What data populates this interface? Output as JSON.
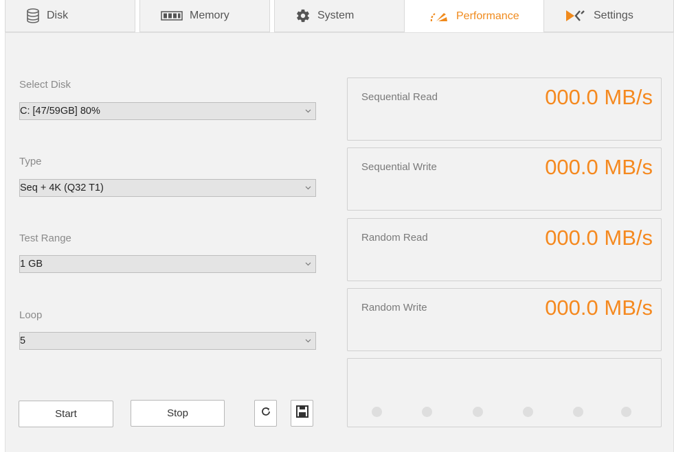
{
  "tabs": [
    {
      "label": "Disk",
      "icon": "database-icon"
    },
    {
      "label": "Memory",
      "icon": "memory-chip-icon"
    },
    {
      "label": "System",
      "icon": "gear-icon"
    },
    {
      "label": "Performance",
      "icon": "speedometer-icon",
      "active": true
    },
    {
      "label": "Settings",
      "icon": "x-logo-icon"
    }
  ],
  "form": {
    "select_disk": {
      "label": "Select Disk",
      "value": "C: [47/59GB] 80%"
    },
    "type": {
      "label": "Type",
      "value": "Seq + 4K (Q32 T1)"
    },
    "test_range": {
      "label": "Test Range",
      "value": "1 GB"
    },
    "loop": {
      "label": "Loop",
      "value": "5"
    }
  },
  "buttons": {
    "start": "Start",
    "stop": "Stop",
    "refresh_icon": "refresh-icon",
    "save_icon": "save-icon"
  },
  "results": [
    {
      "label": "Sequential Read",
      "value": "000.0 MB/s"
    },
    {
      "label": "Sequential Write",
      "value": "000.0 MB/s"
    },
    {
      "label": "Random Read",
      "value": "000.0 MB/s"
    },
    {
      "label": "Random Write",
      "value": "000.0 MB/s"
    }
  ],
  "progress_dots_count": 6,
  "colors": {
    "accent": "#f5891f",
    "panel": "#f2f2f2",
    "dot": "#dedede"
  }
}
